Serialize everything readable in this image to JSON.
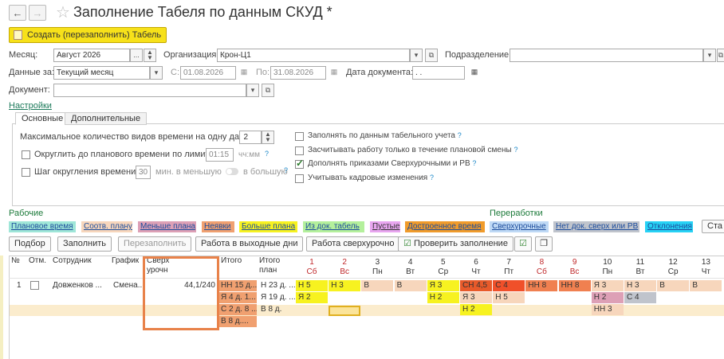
{
  "window": {
    "title": "Заполнение Табеля по данным СКУД *"
  },
  "toolbar": {
    "create_label": "Создать (перезаполнить) Табель"
  },
  "filters": {
    "month_label": "Месяц:",
    "month_value": "Август 2026",
    "org_label": "Организация:",
    "org_value": "Крон-Ц1",
    "dept_label": "Подразделение:",
    "dept_value": "",
    "data_for_label": "Данные за:",
    "data_for_value": "Текущий месяц",
    "from_label": "С:",
    "from_value": "01.08.2026",
    "to_label": "По:",
    "to_value": "31.08.2026",
    "doc_date_label": "Дата документа:",
    "doc_date_value": ". .",
    "document_label": "Документ:",
    "document_value": ""
  },
  "settings": {
    "link": "Настройки",
    "tabs": [
      "Основные",
      "Дополнительные"
    ],
    "max_types_label": "Максимальное количество видов времени на одну дату:",
    "max_types_value": "2",
    "round_label": "Округлить до планового времени по лимиту",
    "round_value": "01:15",
    "round_unit": "чч:мм",
    "step_label": "Шаг округления времени",
    "step_value": "30",
    "step_less": "мин. в меньшую",
    "step_more": "в большую",
    "opt1": "Заполнять по данным табельного учета",
    "opt2": "Засчитывать работу только в течение плановой смены",
    "opt3": "Дополнять приказами Сверхурочными и РВ",
    "opt4": "Учитывать кадровые изменения",
    "q": "?"
  },
  "legend": {
    "work_title": "Рабочие",
    "overtime_title": "Переработки",
    "items": [
      {
        "label": "Плановое время",
        "color": "#9fe6d8"
      },
      {
        "label": "Соотв. плану",
        "color": "#f7d6bc"
      },
      {
        "label": "Меньше плана",
        "color": "#dda0b6"
      },
      {
        "label": "Неявки",
        "color": "#f0a070"
      },
      {
        "label": "Больше плана",
        "color": "#f7f220"
      },
      {
        "label": "Из док. табель",
        "color": "#b4f09c"
      },
      {
        "label": "Пустые",
        "color": "#e8a6f0"
      },
      {
        "label": "Достроенное время",
        "color": "#f09b2b"
      },
      {
        "label": "Сверхурочные",
        "color": "#bfd9f5"
      },
      {
        "label": "Нет док. сверх или РВ",
        "color": "#c0c4cc"
      },
      {
        "label": "Отклонения",
        "color": "#27d2f5"
      }
    ],
    "extra_button": "Ста"
  },
  "grid_buttons": {
    "select": "Подбор",
    "fill": "Заполнить",
    "refill": "Перезаполнить",
    "weekend": "Работа в выходные дни",
    "overtime": "Работа сверхурочно",
    "check": "Проверить заполнение"
  },
  "table": {
    "headers": {
      "n": "№",
      "mark": "Отм.",
      "employee": "Сотрудник",
      "schedule": "График",
      "overtime": "Сверх урочн",
      "total": "Итого",
      "total_plan": "Итого план"
    },
    "days": [
      {
        "d": "1",
        "w": "Сб",
        "red": true
      },
      {
        "d": "2",
        "w": "Вс",
        "red": true
      },
      {
        "d": "3",
        "w": "Пн",
        "red": false
      },
      {
        "d": "4",
        "w": "Вт",
        "red": false
      },
      {
        "d": "5",
        "w": "Ср",
        "red": false
      },
      {
        "d": "6",
        "w": "Чт",
        "red": false
      },
      {
        "d": "7",
        "w": "Пт",
        "red": false
      },
      {
        "d": "8",
        "w": "Сб",
        "red": true
      },
      {
        "d": "9",
        "w": "Вс",
        "red": true
      },
      {
        "d": "10",
        "w": "Пн",
        "red": false
      },
      {
        "d": "11",
        "w": "Вт",
        "red": false
      },
      {
        "d": "12",
        "w": "Ср",
        "red": false
      },
      {
        "d": "13",
        "w": "Чт",
        "red": false
      }
    ],
    "row": {
      "n": "1",
      "employee": "Довженков ...",
      "schedule": "Смена...",
      "overtime": "44,1/240",
      "totals": [
        "НН 15 д...",
        "Я 4 д. 1...",
        "С 2 д. 8 ...",
        "В 8 д...."
      ],
      "plans": [
        "Н 23 д. ...",
        "Я 19 д. ...",
        "В 8 д."
      ],
      "day_cells": [
        [
          "Н 5",
          "Н 3",
          "В",
          "В",
          "Я 3",
          "СН 4,5",
          "С 4",
          "НН 8",
          "НН 8",
          "Я 3",
          "Н 3",
          "В",
          "В"
        ],
        [
          "Я 2",
          "",
          "",
          "",
          "Н 2",
          "Я 3",
          "Н 5",
          "",
          "",
          "Н 2",
          "С 4",
          "",
          ""
        ],
        [
          "",
          "",
          "",
          "",
          "",
          "Н 2",
          "",
          "",
          "",
          "НН 3",
          "",
          "",
          ""
        ]
      ]
    }
  }
}
